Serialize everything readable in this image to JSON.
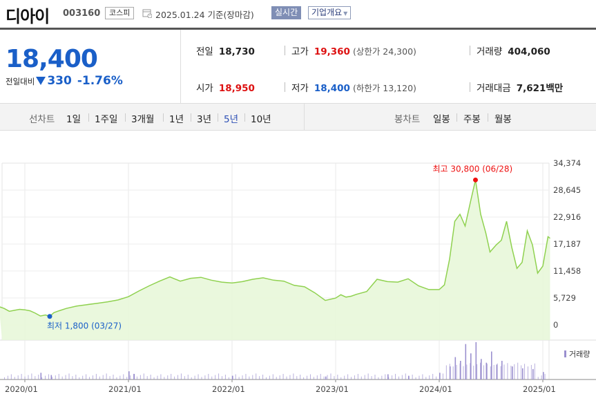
{
  "header": {
    "stock_name": "디아이",
    "stock_code": "003160",
    "market": "코스피",
    "date_text": "2025.01.24 기준(장마감)",
    "realtime_label": "실시간",
    "overview_label": "기업개요"
  },
  "price": {
    "current": "18,400",
    "change_label": "전일대비",
    "change_value": "330",
    "change_pct": "-1.76%"
  },
  "info": {
    "prev_label": "전일",
    "prev_value": "18,730",
    "high_label": "고가",
    "high_value": "19,360",
    "upper_limit": "(상한가 24,300)",
    "volume_label": "거래량",
    "volume_value": "404,060",
    "open_label": "시가",
    "open_value": "18,950",
    "low_label": "저가",
    "low_value": "18,400",
    "lower_limit": "(하한가 13,120)",
    "amount_label": "거래대금",
    "amount_value": "7,621",
    "amount_unit": "백만"
  },
  "tabs": {
    "line_title": "선차트",
    "line_items": [
      "1일",
      "1주일",
      "3개월",
      "1년",
      "3년",
      "5년",
      "10년"
    ],
    "active_item": "5년",
    "candle_title": "봉차트",
    "candle_items": [
      "일봉",
      "주봉",
      "월봉"
    ]
  },
  "colors": {
    "line": "#8fd14f",
    "fill": "#e8f7d9",
    "high_marker": "#e11",
    "low_marker": "#1a5fc8",
    "volume": "#9a8fcf"
  },
  "chart_data": {
    "type": "area",
    "x_ticks": [
      "2020/01",
      "2021/01",
      "2022/01",
      "2023/01",
      "2024/01",
      "2025/01"
    ],
    "y_ticks": [
      "34,374",
      "28,645",
      "22,916",
      "17,187",
      "11,458",
      "5,729",
      "0"
    ],
    "ylim": [
      0,
      34374
    ],
    "high_annotation": "최고 30,800 (06/28)",
    "low_annotation": "최저 1,800 (03/27)",
    "volume_legend": "거래량",
    "x": [
      2019.75,
      2019.8,
      2019.85,
      2019.9,
      2019.95,
      2020.0,
      2020.05,
      2020.1,
      2020.15,
      2020.2,
      2020.24,
      2020.28,
      2020.33,
      2020.4,
      2020.5,
      2020.6,
      2020.7,
      2020.8,
      2020.9,
      2021.0,
      2021.1,
      2021.2,
      2021.3,
      2021.4,
      2021.5,
      2021.6,
      2021.7,
      2021.8,
      2021.9,
      2022.0,
      2022.1,
      2022.2,
      2022.3,
      2022.4,
      2022.5,
      2022.6,
      2022.7,
      2022.8,
      2022.9,
      2023.0,
      2023.05,
      2023.1,
      2023.15,
      2023.2,
      2023.3,
      2023.4,
      2023.5,
      2023.6,
      2023.7,
      2023.8,
      2023.9,
      2024.0,
      2024.05,
      2024.1,
      2024.15,
      2024.2,
      2024.25,
      2024.3,
      2024.35,
      2024.4,
      2024.45,
      2024.49,
      2024.55,
      2024.6,
      2024.65,
      2024.7,
      2024.75,
      2024.8,
      2024.85,
      2024.9,
      2024.95,
      2025.0,
      2025.05,
      2025.07
    ],
    "y": [
      3900,
      3500,
      2900,
      3100,
      3300,
      3200,
      3000,
      2500,
      1900,
      2100,
      1800,
      2600,
      3000,
      3500,
      4000,
      4300,
      4600,
      4900,
      5300,
      6000,
      7200,
      8300,
      9300,
      10200,
      9300,
      9900,
      10100,
      9500,
      9100,
      8900,
      9200,
      9700,
      10000,
      9500,
      9300,
      8400,
      8100,
      6800,
      5200,
      5700,
      6400,
      5900,
      6100,
      6500,
      7100,
      9700,
      9200,
      9100,
      9800,
      8300,
      7500,
      7500,
      8500,
      14000,
      22000,
      23500,
      21000,
      26000,
      30800,
      23500,
      19500,
      15500,
      17000,
      18000,
      22000,
      16500,
      12000,
      13300,
      20000,
      17000,
      11000,
      12500,
      18730,
      18400
    ],
    "volume_x": [
      2020.15,
      2020.25,
      2021.0,
      2021.05,
      2022.0,
      2022.9,
      2023.5,
      2023.7,
      2024.0,
      2024.1,
      2024.15,
      2024.2,
      2024.25,
      2024.3,
      2024.35,
      2024.4,
      2024.45,
      2024.5,
      2024.55,
      2024.6,
      2024.7,
      2024.8,
      2024.9,
      2025.0
    ],
    "volume": [
      0.18,
      0.12,
      0.22,
      0.15,
      0.1,
      0.08,
      0.14,
      0.1,
      0.18,
      0.35,
      0.6,
      0.5,
      0.95,
      0.7,
      1.0,
      0.55,
      0.45,
      0.75,
      0.4,
      0.5,
      0.35,
      0.3,
      0.28,
      0.2
    ]
  }
}
